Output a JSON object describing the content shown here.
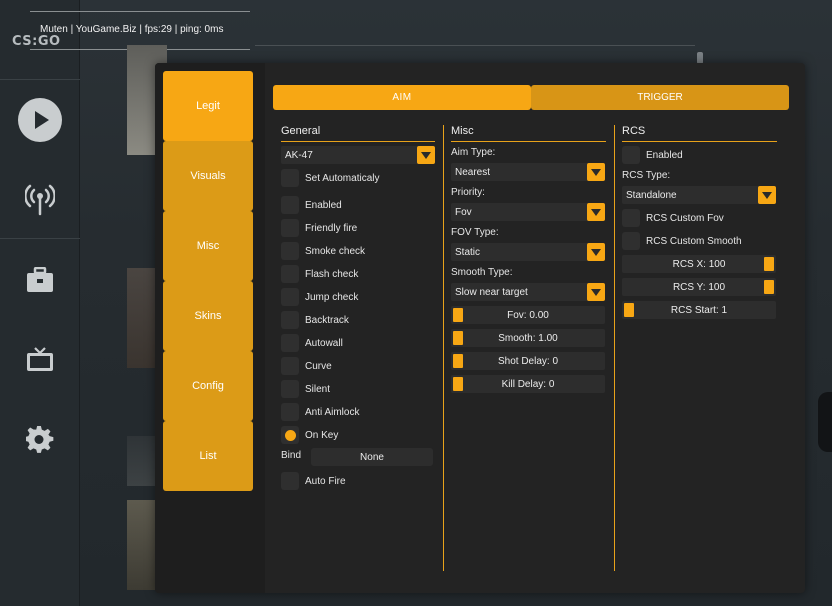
{
  "hud": {
    "text": "Muten | YouGame.Biz | fps:29 | ping: 0ms"
  },
  "logo": {
    "text": "CS:GO"
  },
  "background_sidebar": {
    "icons": [
      "play-icon",
      "broadcast-icon",
      "briefcase-icon",
      "tv-icon",
      "gear-icon"
    ]
  },
  "menu": {
    "nav": [
      {
        "label": "Legit",
        "active": true
      },
      {
        "label": "Visuals",
        "active": false
      },
      {
        "label": "Misc",
        "active": false
      },
      {
        "label": "Skins",
        "active": false
      },
      {
        "label": "Config",
        "active": false
      },
      {
        "label": "List",
        "active": false
      }
    ],
    "tabs": {
      "aim": "AIM",
      "trigger": "TRIGGER"
    },
    "general": {
      "title": "General",
      "weapon": "AK-47",
      "set_auto": "Set Automaticaly",
      "checks": [
        "Enabled",
        "Friendly fire",
        "Smoke check",
        "Flash check",
        "Jump check",
        "Backtrack",
        "Autowall",
        "Curve",
        "Silent",
        "Anti Aimlock",
        "On Key"
      ],
      "bind_label": "Bind",
      "bind_value": "None",
      "auto_fire": "Auto Fire"
    },
    "misc": {
      "title": "Misc",
      "aim_type_label": "Aim Type:",
      "aim_type_value": "Nearest",
      "priority_label": "Priority:",
      "priority_value": "Fov",
      "fov_type_label": "FOV Type:",
      "fov_type_value": "Static",
      "smooth_type_label": "Smooth Type:",
      "smooth_type_value": "Slow near target",
      "sliders": [
        "Fov: 0.00",
        "Smooth: 1.00",
        "Shot Delay: 0",
        "Kill Delay: 0"
      ]
    },
    "rcs": {
      "title": "RCS",
      "enabled": "Enabled",
      "type_label": "RCS Type:",
      "type_value": "Standalone",
      "custom_fov": "RCS Custom Fov",
      "custom_smooth": "RCS Custom Smooth",
      "sliders": [
        "RCS X: 100",
        "RCS Y: 100",
        "RCS Start: 1"
      ]
    }
  },
  "colors": {
    "accent": "#f7a714",
    "accent_dark": "#d89516",
    "panel": "#232323"
  }
}
